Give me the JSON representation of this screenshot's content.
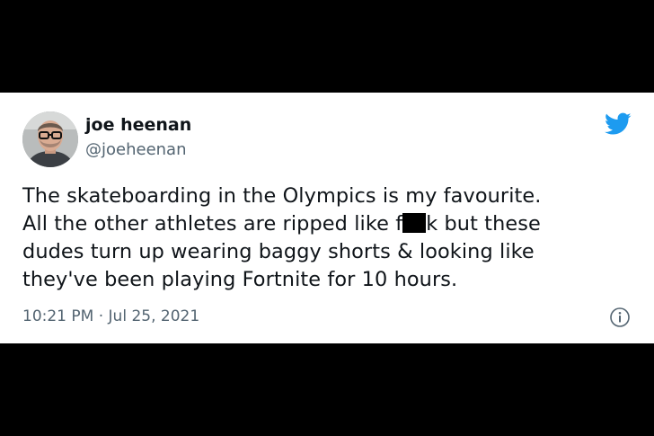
{
  "author": {
    "display_name": "joe heenan",
    "handle": "@joeheenan"
  },
  "tweet": {
    "line1": "The skateboarding in the Olympics is my favourite.",
    "line2_before": "All the other athletes are ripped like f",
    "line2_after": "k but these",
    "line3": "dudes turn up wearing baggy shorts & looking like",
    "line4": "they've been playing Fortnite for 10 hours."
  },
  "meta": {
    "timestamp": "10:21 PM · Jul 25, 2021"
  },
  "icons": {
    "brand": "twitter-bird-icon",
    "info": "info-icon"
  },
  "colors": {
    "brand_blue": "#1d9bf0",
    "text_primary": "#0f1419",
    "text_secondary": "#536471",
    "background_outer": "#000000",
    "card_background": "#ffffff"
  }
}
